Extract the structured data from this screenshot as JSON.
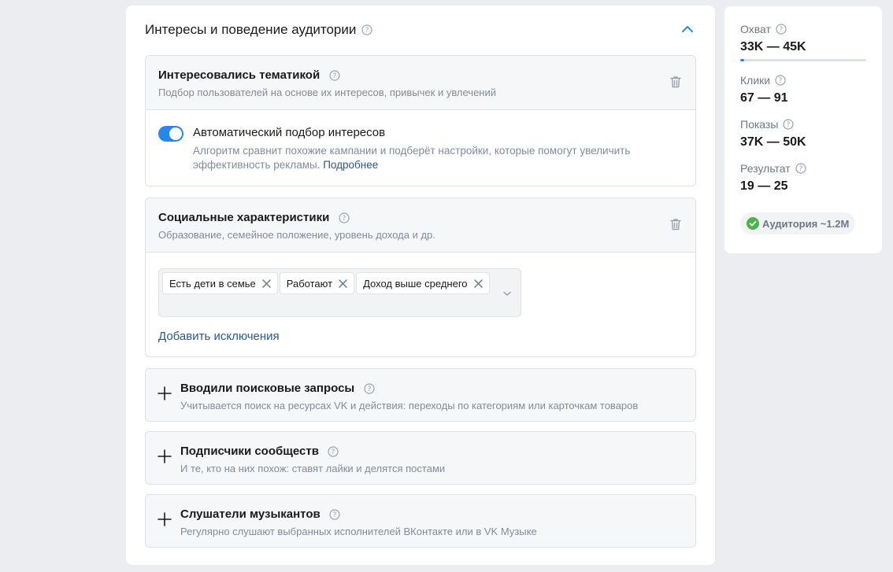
{
  "section": {
    "title": "Интересы и поведение аудитории"
  },
  "interests": {
    "title": "Интересовались тематикой",
    "subtitle": "Подбор пользователей на основе их интересов, привычек и увлечений",
    "auto": {
      "enabled": true,
      "title": "Автоматический подбор интересов",
      "description": "Алгоритм сравнит похожие кампании и подберёт настройки, которые помогут увеличить эффективность рекламы.",
      "link": "Подробнее"
    }
  },
  "social": {
    "title": "Социальные характеристики",
    "subtitle": "Образование, семейное положение, уровень дохода и др.",
    "tags": [
      "Есть дети в семье",
      "Работают",
      "Доход выше среднего"
    ],
    "add_exclusions": "Добавить исключения"
  },
  "collapsed_blocks": [
    {
      "title": "Вводили поисковые запросы",
      "subtitle": "Учитывается поиск на ресурсах VK и действия: переходы по категориям или карточкам товаров"
    },
    {
      "title": "Подписчики сообществ",
      "subtitle": "И те, кто на них похож: ставят лайки и делятся постами"
    },
    {
      "title": "Слушатели музыкантов",
      "subtitle": "Регулярно слушают выбранных исполнителей ВКонтакте или в VK Музыке"
    }
  ],
  "forecast": {
    "metrics": [
      {
        "label": "Охват",
        "value": "33K — 45K",
        "progress": 0.03
      },
      {
        "label": "Клики",
        "value": "67 — 91"
      },
      {
        "label": "Показы",
        "value": "37K — 50K"
      },
      {
        "label": "Результат",
        "value": "19 — 25"
      }
    ],
    "audience_badge": "Аудитория ~1.2M"
  },
  "colors": {
    "accent": "#2688eb",
    "link": "#2a5885",
    "success": "#4bb34b",
    "muted": "#818c99"
  }
}
